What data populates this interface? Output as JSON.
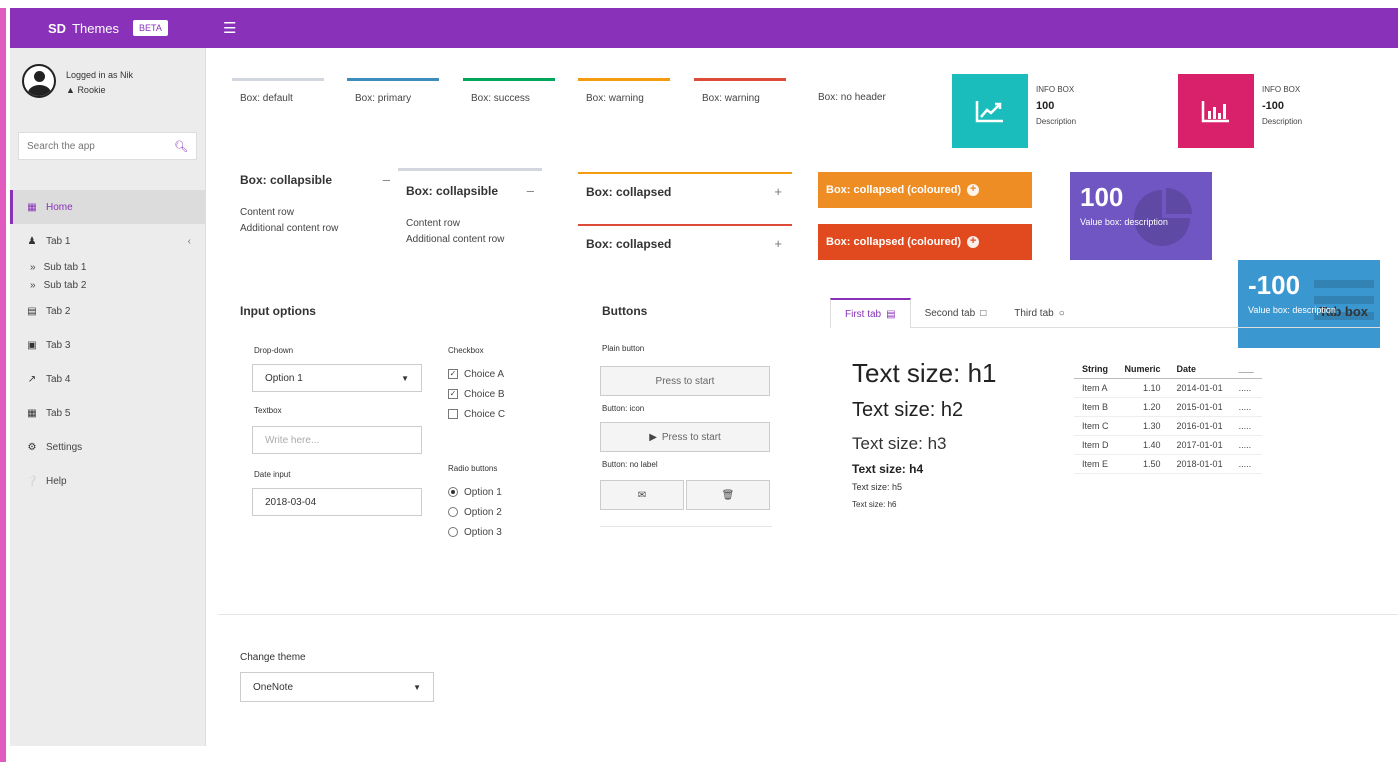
{
  "header": {
    "brand_bold": "SD",
    "brand_rest": "Themes",
    "badge": "BETA",
    "menu_icon": "hamburger-icon"
  },
  "sidebar": {
    "user_line": "Logged in as Nik",
    "user_status": "Rookie",
    "search_placeholder": "Search the app",
    "items": [
      {
        "label": "Home",
        "icon": "grid-icon"
      },
      {
        "label": "Tab 1",
        "icon": "users-icon"
      },
      {
        "label": "Sub tab 1"
      },
      {
        "label": "Sub tab 2"
      },
      {
        "label": "Tab 2",
        "icon": "file-icon"
      },
      {
        "label": "Tab 3",
        "icon": "card-icon"
      },
      {
        "label": "Tab 4",
        "icon": "line-chart-icon"
      },
      {
        "label": "Tab 5",
        "icon": "calendar-icon"
      },
      {
        "label": "Settings",
        "icon": "gear-icon"
      },
      {
        "label": "Help",
        "icon": "question-icon"
      }
    ]
  },
  "boxes": {
    "default": "Box: default",
    "primary": "Box: primary",
    "success": "Box: success",
    "warning1": "Box: warning",
    "warning2": "Box: warning",
    "no_header": "Box: no header"
  },
  "infoboxes": [
    {
      "title": "INFO BOX",
      "value": "100",
      "desc": "Description",
      "color": "#1bbcbc",
      "icon": "line-chart-icon"
    },
    {
      "title": "INFO BOX",
      "value": "-100",
      "desc": "Description",
      "color": "#d9206a",
      "icon": "bar-chart-icon"
    }
  ],
  "collapsible": [
    {
      "title": "Box: collapsible",
      "toggle": "–",
      "rows": [
        "Content row",
        "Additional content row"
      ]
    },
    {
      "title": "Box: collapsible",
      "toggle": "–",
      "rows": [
        "Content row",
        "Additional content row"
      ]
    }
  ],
  "collapsed": [
    {
      "title": "Box: collapsed",
      "toggle": "+"
    },
    {
      "title": "Box: collapsed",
      "toggle": "+"
    }
  ],
  "collapsed_coloured": [
    {
      "title": "Box: collapsed (coloured)",
      "toggle": "+",
      "color": "#ef8d25"
    },
    {
      "title": "Box: collapsed (coloured)",
      "toggle": "+",
      "color": "#e1491e"
    }
  ],
  "valueboxes": [
    {
      "value": "100",
      "desc": "Value box: description",
      "color": "#6f56c2",
      "icon": "pie-chart-icon"
    },
    {
      "value": "-100",
      "desc": "Value box: description",
      "color": "#3a97cf",
      "icon": "list-icon"
    }
  ],
  "inputs": {
    "title": "Input options",
    "dropdown_label": "Drop-down",
    "dropdown_value": "Option 1",
    "textbox_label": "Textbox",
    "textbox_placeholder": "Write here...",
    "date_label": "Date input",
    "date_value": "2018-03-04",
    "checkbox_label": "Checkbox",
    "checkboxes": [
      {
        "label": "Choice A",
        "checked": true
      },
      {
        "label": "Choice B",
        "checked": true
      },
      {
        "label": "Choice C",
        "checked": false
      }
    ],
    "radio_label": "Radio buttons",
    "radios": [
      {
        "label": "Option 1",
        "selected": true
      },
      {
        "label": "Option 2",
        "selected": false
      },
      {
        "label": "Option 3",
        "selected": false
      }
    ]
  },
  "buttons": {
    "title": "Buttons",
    "plain_label": "Plain button",
    "plain_text": "Press to start",
    "icon_label": "Button: icon",
    "icon_text": "Press to start",
    "nolabel_label": "Button: no label"
  },
  "tabbox": {
    "title": "Tab box",
    "tabs": [
      {
        "label": "First tab",
        "icon": "file-icon"
      },
      {
        "label": "Second tab",
        "icon": "bookmark-icon"
      },
      {
        "label": "Third tab",
        "icon": "circle-icon"
      }
    ],
    "headings": [
      "Text size: h1",
      "Text size: h2",
      "Text size: h3",
      "Text size: h4",
      "Text size: h5",
      "Text size: h6"
    ],
    "table": {
      "columns": [
        "String",
        "Numeric",
        "Date",
        "___"
      ],
      "rows": [
        [
          "Item A",
          "1.10",
          "2014-01-01",
          "....."
        ],
        [
          "Item B",
          "1.20",
          "2015-01-01",
          "....."
        ],
        [
          "Item C",
          "1.30",
          "2016-01-01",
          "....."
        ],
        [
          "Item D",
          "1.40",
          "2017-01-01",
          "....."
        ],
        [
          "Item E",
          "1.50",
          "2018-01-01",
          "....."
        ]
      ]
    }
  },
  "theme": {
    "label": "Change theme",
    "value": "OneNote"
  }
}
